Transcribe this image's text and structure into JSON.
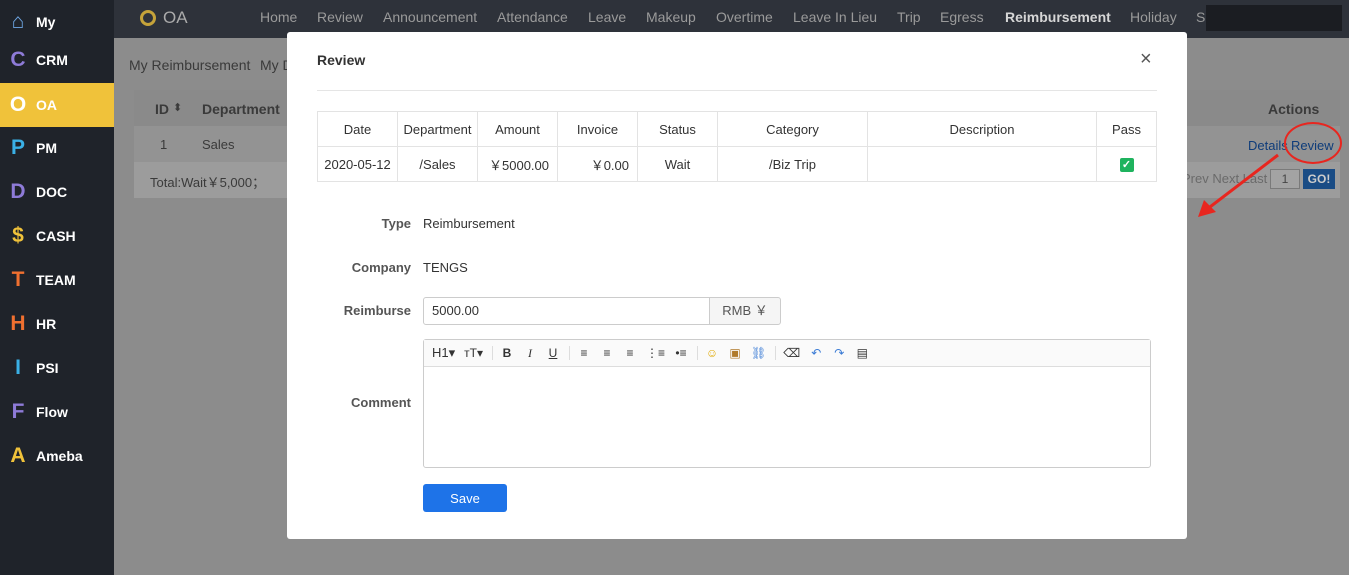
{
  "sidebar": {
    "items": [
      {
        "letter": "⌂",
        "label": "My",
        "color": "#6fa8e6"
      },
      {
        "letter": "C",
        "label": "CRM",
        "color": "#8e7bd8"
      },
      {
        "letter": "O",
        "label": "OA",
        "color": "#ffffff",
        "active": true
      },
      {
        "letter": "P",
        "label": "PM",
        "color": "#3ab0e6"
      },
      {
        "letter": "D",
        "label": "DOC",
        "color": "#8e7bd8"
      },
      {
        "letter": "$",
        "label": "CASH",
        "color": "#f0c23a"
      },
      {
        "letter": "T",
        "label": "TEAM",
        "color": "#f07030"
      },
      {
        "letter": "H",
        "label": "HR",
        "color": "#f07030"
      },
      {
        "letter": "I",
        "label": "PSI",
        "color": "#3ab0e6"
      },
      {
        "letter": "F",
        "label": "Flow",
        "color": "#8e7bd8"
      },
      {
        "letter": "A",
        "label": "Ameba",
        "color": "#f0c23a"
      }
    ],
    "collapse_icon": "‹"
  },
  "topnav": {
    "logo": "OA",
    "items": [
      "Home",
      "Review",
      "Announcement",
      "Attendance",
      "Leave",
      "Makeup",
      "Overtime",
      "Leave In Lieu",
      "Trip",
      "Egress",
      "Reimbursement",
      "Holiday",
      "S"
    ],
    "active": "Reimbursement"
  },
  "background": {
    "breadcrumb_1": "My Reimbursement",
    "breadcrumb_2": "My D",
    "col_id": "ID",
    "col_department": "Department",
    "col_actions": "Actions",
    "row_id": "1",
    "row_department": "Sales",
    "link_details": "Details",
    "link_review": "Review",
    "total": "Total:Wait￥5,000；",
    "pager_text": "Prev Next Last",
    "page_value": "1",
    "go": "GO!"
  },
  "modal": {
    "title": "Review",
    "close": "×",
    "table": {
      "headers": [
        "Date",
        "Department",
        "Amount",
        "Invoice",
        "Status",
        "Category",
        "Description",
        "Pass"
      ],
      "row": [
        "2020-05-12",
        "/Sales",
        "￥5000.00",
        "￥0.00",
        "Wait",
        "/Biz Trip",
        "",
        "✓"
      ]
    },
    "type_label": "Type",
    "type_value": "Reimbursement",
    "company_label": "Company",
    "company_value": "TENGS",
    "reimburse_label": "Reimburse",
    "reimburse_value": "5000.00",
    "reimburse_unit": "RMB ￥",
    "comment_label": "Comment",
    "toolbar": [
      "H1▾",
      "тT▾",
      "B",
      "I",
      "U",
      "≡",
      "≡",
      "≡",
      "⋮≡",
      "•≡",
      "☺",
      "▣",
      "⛓",
      "⌫",
      "↶",
      "↷",
      "▤"
    ],
    "save": "Save"
  },
  "colors": {
    "accent": "#1e73e8",
    "sidebar_active": "#f0c23a",
    "annotation": "#e8261f"
  }
}
